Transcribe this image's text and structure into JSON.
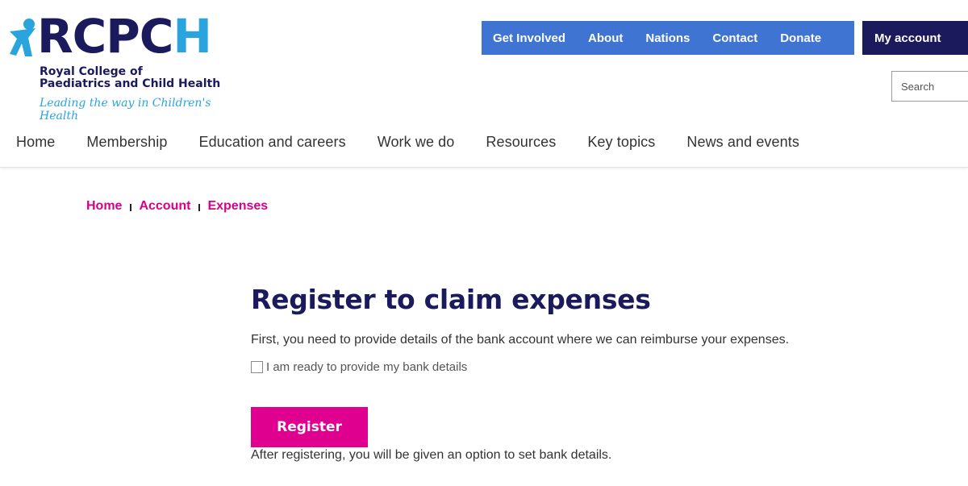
{
  "brand": {
    "wordmark_part1": "RCPC",
    "wordmark_part2": "H",
    "subtitle_line1": "Royal College of",
    "subtitle_line2": "Paediatrics and Child Health",
    "tagline": "Leading the way in Children's Health",
    "colors": {
      "navy": "#1b1a5c",
      "cyan": "#2aa4dd",
      "magenta": "#e0008f",
      "blue": "#3f74d3"
    }
  },
  "utility_nav": {
    "items": [
      {
        "label": "Get Involved"
      },
      {
        "label": "About"
      },
      {
        "label": "Nations"
      },
      {
        "label": "Contact"
      },
      {
        "label": "Donate"
      }
    ],
    "my_account": "My account"
  },
  "search": {
    "placeholder": "Search"
  },
  "main_nav": {
    "items": [
      {
        "label": "Home"
      },
      {
        "label": "Membership"
      },
      {
        "label": "Education and careers"
      },
      {
        "label": "Work we do"
      },
      {
        "label": "Resources"
      },
      {
        "label": "Key topics"
      },
      {
        "label": "News and events"
      }
    ]
  },
  "breadcrumb": {
    "items": [
      {
        "label": "Home"
      },
      {
        "label": "Account"
      },
      {
        "label": "Expenses"
      }
    ]
  },
  "content": {
    "title": "Register to claim expenses",
    "intro": "First, you need to provide details of the bank account where we can reimburse your expenses.",
    "checkbox_label": "I am ready to provide my bank details",
    "checkbox_checked": false,
    "register_button": "Register",
    "after_text": "After registering, you will be given an option to set bank details."
  }
}
